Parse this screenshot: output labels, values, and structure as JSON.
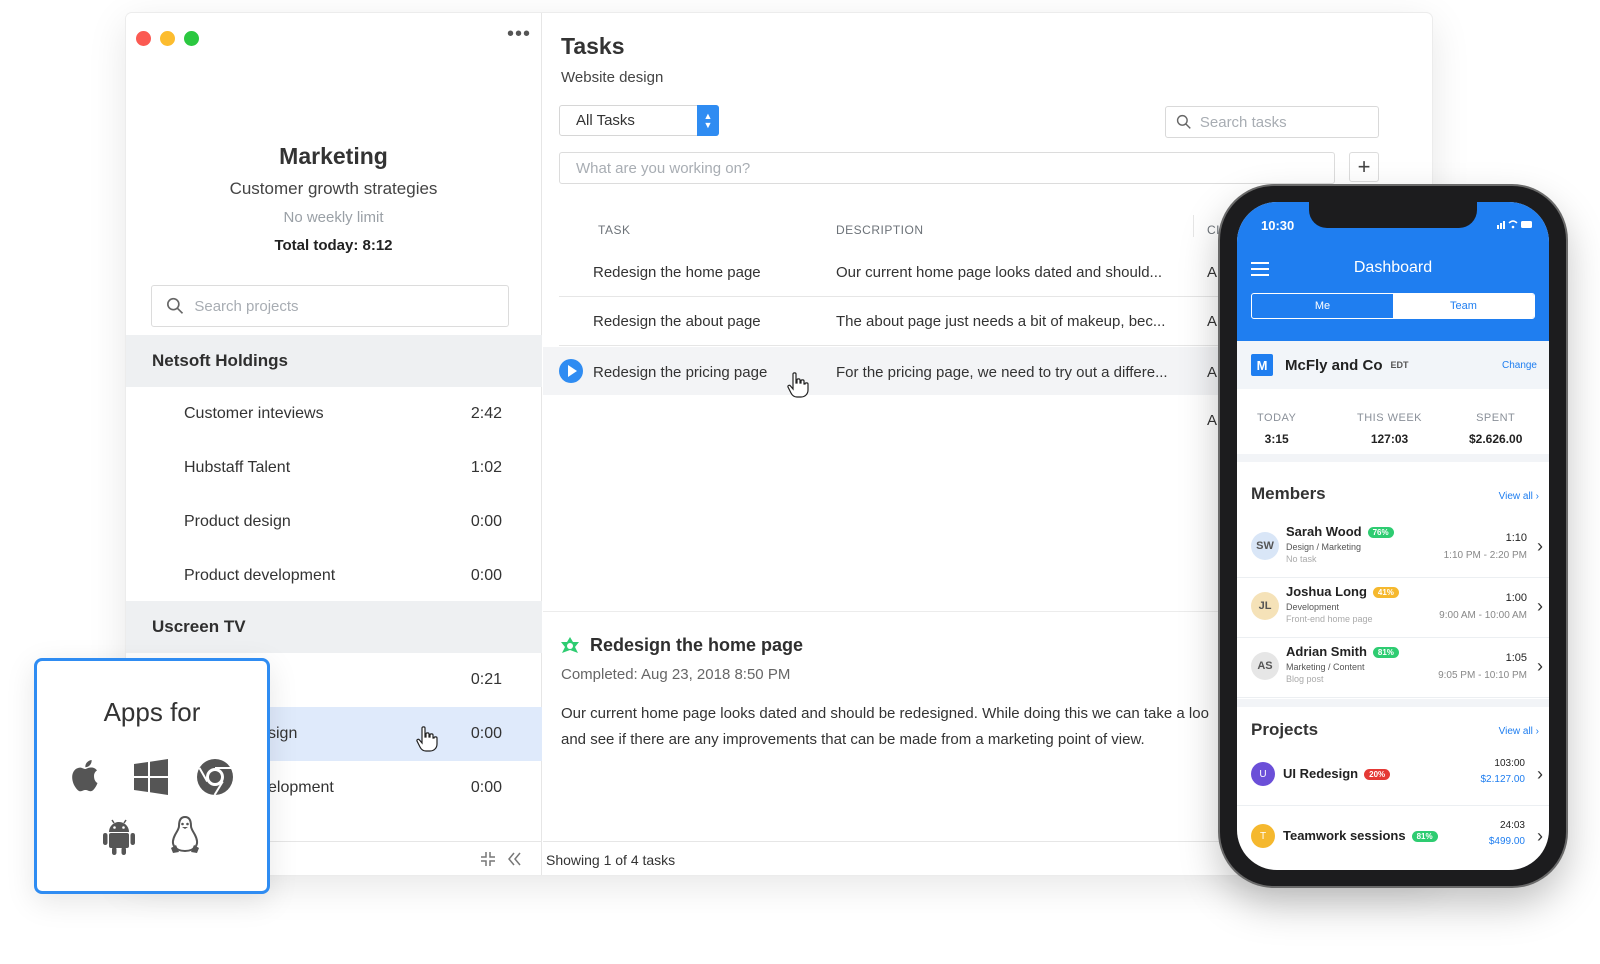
{
  "window": {
    "more_label": "•••"
  },
  "project": {
    "title": "Marketing",
    "subtitle": "Customer growth strategies",
    "limit": "No weekly limit",
    "total_today": "Total today: 8:12"
  },
  "search_projects": {
    "placeholder": "Search projects"
  },
  "groups": [
    {
      "name": "Netsoft Holdings",
      "items": [
        {
          "name": "Customer inteviews",
          "time": "2:42"
        },
        {
          "name": "Hubstaff Talent",
          "time": "1:02"
        },
        {
          "name": "Product design",
          "time": "0:00"
        },
        {
          "name": "Product development",
          "time": "0:00"
        }
      ]
    },
    {
      "name": "Uscreen TV",
      "items": [
        {
          "name": "",
          "time": "0:21"
        },
        {
          "name": "sign",
          "time": "0:00"
        },
        {
          "name": "elopment",
          "time": "0:00"
        }
      ]
    }
  ],
  "tasks": {
    "title": "Tasks",
    "subtitle": "Website design",
    "filter": "All Tasks",
    "search_placeholder": "Search tasks",
    "working_placeholder": "What are you working on?",
    "add_label": "+",
    "columns": {
      "task": "TASK",
      "description": "DESCRIPTION",
      "extra": "CI"
    },
    "rows": [
      {
        "task": "Redesign the home page",
        "description": "Our current home page looks dated and should...",
        "extra": "A"
      },
      {
        "task": "Redesign the about page",
        "description": "The about page just needs a bit of makeup, bec...",
        "extra": "A"
      },
      {
        "task": "Redesign the pricing page",
        "description": "For the pricing page, we need to try out a differe...",
        "extra": "A"
      },
      {
        "task": "",
        "description": "",
        "extra": "A"
      }
    ],
    "footer": "Showing 1 of 4 tasks"
  },
  "detail": {
    "title": "Redesign the home page",
    "completed": "Completed: Aug 23, 2018 8:50 PM",
    "line1": "Our current home page looks dated and should be redesigned. While doing this we can take a loo",
    "line2": "and see if there are any improvements that can be made from a marketing point of view."
  },
  "apps": {
    "title": "Apps for",
    "icons": [
      "apple-icon",
      "windows-icon",
      "chrome-icon",
      "android-icon",
      "linux-icon"
    ]
  },
  "phone": {
    "time": "10:30",
    "header": "Dashboard",
    "seg_me": "Me",
    "seg_team": "Team",
    "org": {
      "badge": "M",
      "name": "McFly and Co",
      "tz": "EDT",
      "change": "Change"
    },
    "stats": [
      {
        "k": "TODAY",
        "v": "3:15"
      },
      {
        "k": "THIS WEEK",
        "v": "127:03"
      },
      {
        "k": "SPENT",
        "v": "$2.626.00"
      }
    ],
    "members_title": "Members",
    "view_all": "View all",
    "members": [
      {
        "name": "Sarah Wood",
        "pct": "76%",
        "pct_color": "#2ecc71",
        "role": "Design / Marketing",
        "task": "No task",
        "total": "1:10",
        "range": "1:10 PM - 2:20 PM"
      },
      {
        "name": "Joshua Long",
        "pct": "41%",
        "pct_color": "#f5b82e",
        "role": "Development",
        "task": "Front-end home page",
        "total": "1:00",
        "range": "9:00 AM - 10:00 AM"
      },
      {
        "name": "Adrian Smith",
        "pct": "81%",
        "pct_color": "#2ecc71",
        "role": "Marketing / Content",
        "task": "Blog post",
        "total": "1:05",
        "range": "9:05 PM - 10:10 PM"
      }
    ],
    "projects_title": "Projects",
    "projects": [
      {
        "initial": "U",
        "color": "#6b4fd8",
        "name": "UI Redesign",
        "pct": "20%",
        "pct_color": "#e53935",
        "total": "103:00",
        "amount": "$2.127.00"
      },
      {
        "initial": "T",
        "color": "#f5b82e",
        "name": "Teamwork sessions",
        "pct": "81%",
        "pct_color": "#2ecc71",
        "total": "24:03",
        "amount": "$499.00"
      }
    ]
  }
}
